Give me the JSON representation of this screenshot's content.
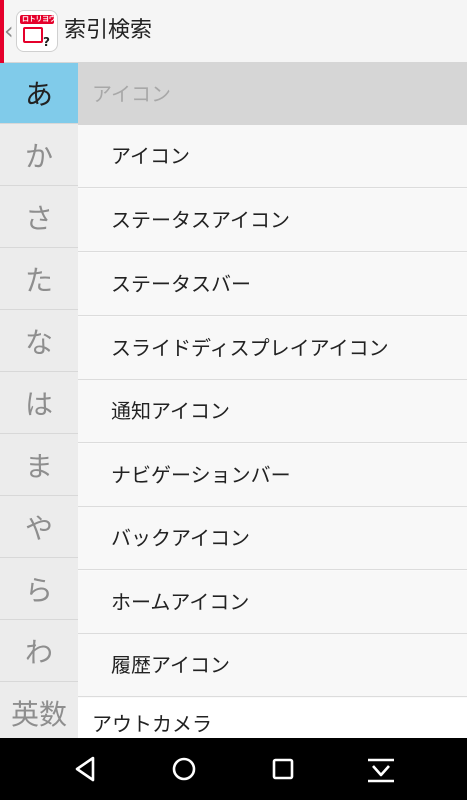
{
  "app_bar": {
    "logo_text": "ロトリヨウ",
    "logo_glyph": "?",
    "title": "索引検索",
    "back_icon": "chevron-left-icon"
  },
  "index": {
    "items": [
      "あ",
      "か",
      "さ",
      "た",
      "な",
      "は",
      "ま",
      "や",
      "ら",
      "わ",
      "英数"
    ],
    "selected": "あ",
    "active_color": "#80cbea"
  },
  "list": {
    "section_header": "アイコン",
    "items": [
      "アイコン",
      "ステータスアイコン",
      "ステータスバー",
      "スライドディスプレイアイコン",
      "通知アイコン",
      "ナビゲーションバー",
      "バックアイコン",
      "ホームアイコン",
      "履歴アイコン"
    ],
    "next_top_item": "アウトカメラ"
  },
  "nav_bar": {
    "buttons": [
      "back-triangle-icon",
      "home-circle-icon",
      "recents-square-icon",
      "hide-keyboard-icon"
    ]
  },
  "colors": {
    "accent_red": "#e5002b",
    "index_active": "#80cbea",
    "section_header_bg": "#d6d6d6"
  }
}
